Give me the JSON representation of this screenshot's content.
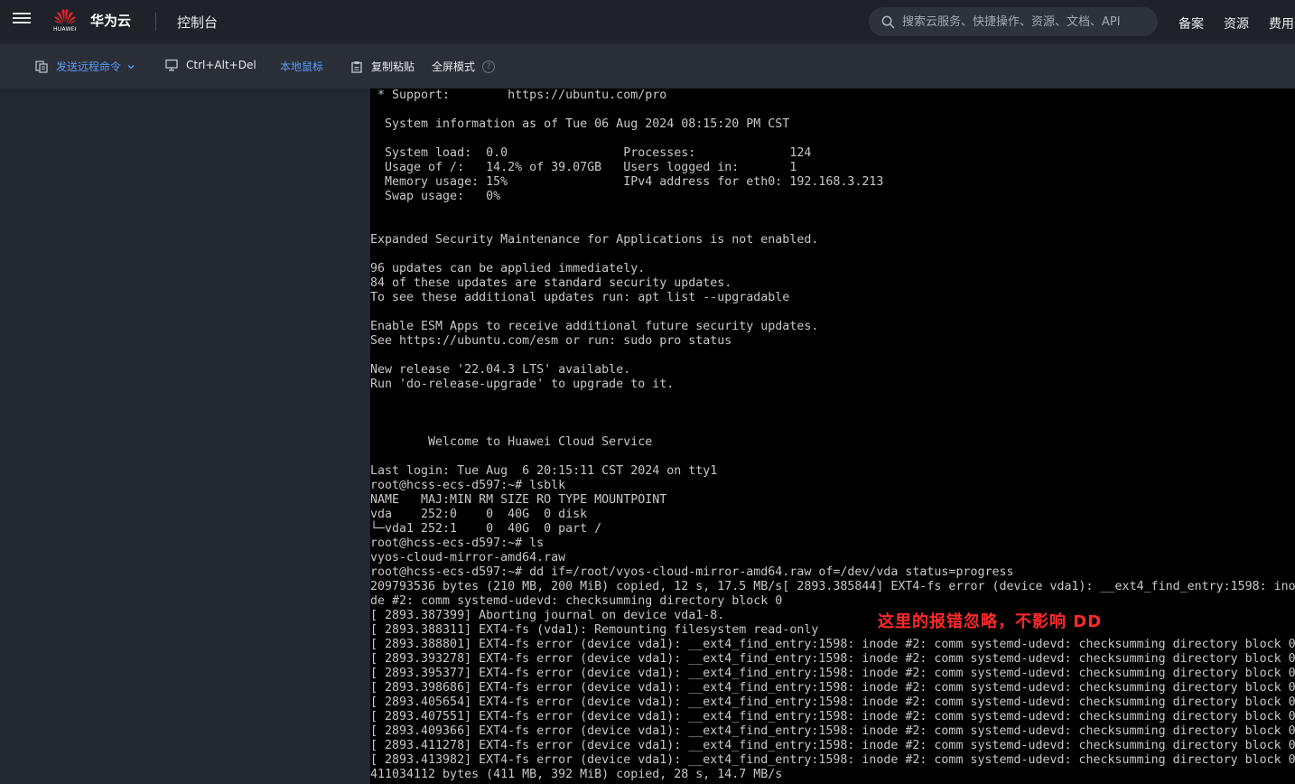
{
  "header": {
    "logo_text": "HUAWEI",
    "brand_name": "华为云",
    "console_label": "控制台",
    "search_placeholder": "搜索云服务、快捷操作、资源、文档、API",
    "links": [
      "备案",
      "资源",
      "费用"
    ]
  },
  "toolbar": {
    "send_remote_cmd": "发送远程命令",
    "ctrl_alt_del": "Ctrl+Alt+Del",
    "local_mouse": "本地鼠标",
    "copy_paste": "复制粘贴",
    "fullscreen": "全屏模式",
    "help": "?"
  },
  "colors": {
    "accent_blue": "#5a9cf8",
    "terminal_bg": "#000000",
    "terminal_fg": "#c8c8c8",
    "note_red": "#ff2a2a",
    "huawei_red": "#e8202a"
  },
  "terminal": {
    "lines": [
      " * Support:        https://ubuntu.com/pro",
      "",
      "  System information as of Tue 06 Aug 2024 08:15:20 PM CST",
      "",
      "  System load:  0.0                Processes:             124",
      "  Usage of /:   14.2% of 39.07GB   Users logged in:       1",
      "  Memory usage: 15%                IPv4 address for eth0: 192.168.3.213",
      "  Swap usage:   0%",
      "",
      "",
      "Expanded Security Maintenance for Applications is not enabled.",
      "",
      "96 updates can be applied immediately.",
      "84 of these updates are standard security updates.",
      "To see these additional updates run: apt list --upgradable",
      "",
      "Enable ESM Apps to receive additional future security updates.",
      "See https://ubuntu.com/esm or run: sudo pro status",
      "",
      "New release '22.04.3 LTS' available.",
      "Run 'do-release-upgrade' to upgrade to it.",
      "",
      "",
      "",
      "        Welcome to Huawei Cloud Service",
      "",
      "Last login: Tue Aug  6 20:15:11 CST 2024 on tty1",
      "root@hcss-ecs-d597:~# lsblk",
      "NAME   MAJ:MIN RM SIZE RO TYPE MOUNTPOINT",
      "vda    252:0    0  40G  0 disk",
      "└─vda1 252:1    0  40G  0 part /",
      "root@hcss-ecs-d597:~# ls",
      "vyos-cloud-mirror-amd64.raw",
      "root@hcss-ecs-d597:~# dd if=/root/vyos-cloud-mirror-amd64.raw of=/dev/vda status=progress",
      "209793536 bytes (210 MB, 200 MiB) copied, 12 s, 17.5 MB/s[ 2893.385844] EXT4-fs error (device vda1): __ext4_find_entry:1598: ino",
      "de #2: comm systemd-udevd: checksumming directory block 0",
      "[ 2893.387399] Aborting journal on device vda1-8.",
      "[ 2893.388311] EXT4-fs (vda1): Remounting filesystem read-only",
      "[ 2893.388801] EXT4-fs error (device vda1): __ext4_find_entry:1598: inode #2: comm systemd-udevd: checksumming directory block 0",
      "[ 2893.393278] EXT4-fs error (device vda1): __ext4_find_entry:1598: inode #2: comm systemd-udevd: checksumming directory block 0",
      "[ 2893.395377] EXT4-fs error (device vda1): __ext4_find_entry:1598: inode #2: comm systemd-udevd: checksumming directory block 0",
      "[ 2893.398686] EXT4-fs error (device vda1): __ext4_find_entry:1598: inode #2: comm systemd-udevd: checksumming directory block 0",
      "[ 2893.405654] EXT4-fs error (device vda1): __ext4_find_entry:1598: inode #2: comm systemd-udevd: checksumming directory block 0",
      "[ 2893.407551] EXT4-fs error (device vda1): __ext4_find_entry:1598: inode #2: comm systemd-udevd: checksumming directory block 0",
      "[ 2893.409366] EXT4-fs error (device vda1): __ext4_find_entry:1598: inode #2: comm systemd-udevd: checksumming directory block 0",
      "[ 2893.411278] EXT4-fs error (device vda1): __ext4_find_entry:1598: inode #2: comm systemd-udevd: checksumming directory block 0",
      "[ 2893.413982] EXT4-fs error (device vda1): __ext4_find_entry:1598: inode #2: comm systemd-udevd: checksumming directory block 0",
      "411034112 bytes (411 MB, 392 MiB) copied, 28 s, 14.7 MB/s"
    ],
    "annotation": "这里的报错忽略，不影响 DD"
  }
}
